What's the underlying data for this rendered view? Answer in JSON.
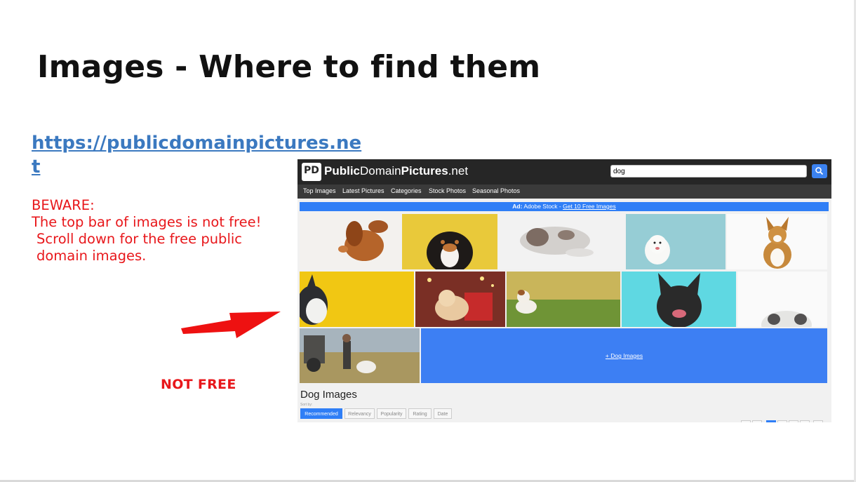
{
  "slide": {
    "title": "Images - Where to find them",
    "link": "https://publicdomainpictures.net",
    "beware_lines": [
      "BEWARE:",
      "The top bar of images is not free!",
      " Scroll down for the free public",
      " domain images."
    ],
    "not_free": "NOT FREE",
    "accent_color": "#e8171b",
    "link_color": "#3b79c0"
  },
  "site": {
    "logo_icon": "PD",
    "logo_bold": "Public",
    "logo_regular": "Domain",
    "logo_bold2": "Pictures",
    "logo_tld": ".net",
    "search_value": "dog",
    "search_icon": "search-icon",
    "nav": [
      "Top Images",
      "Latest Pictures",
      "Categories",
      "Stock Photos",
      "Seasonal Photos"
    ],
    "ad_prefix": "Ad:",
    "ad_text": "Adobe Stock -",
    "ad_link": "Get 10 Free Images",
    "more_tile": "+ Dog Images",
    "heading": "Dog Images",
    "sort_label": "Sort by:",
    "sort_options": [
      "Recommended",
      "Relevancy",
      "Popularity",
      "Rating",
      "Date"
    ],
    "sort_selected": "Recommended",
    "brand_color": "#2f7ef6"
  }
}
